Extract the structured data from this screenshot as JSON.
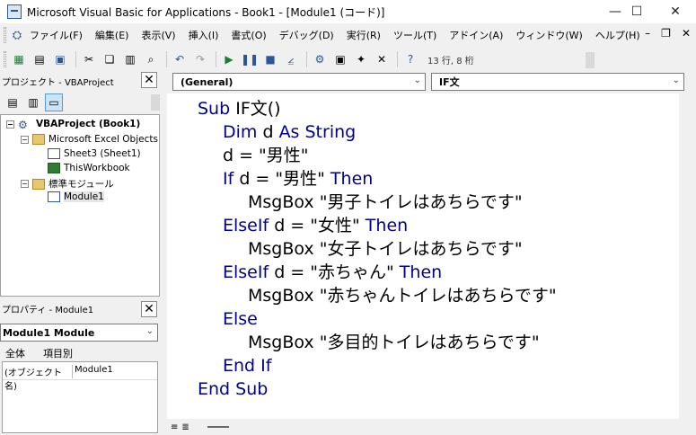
{
  "window": {
    "title": "Microsoft Visual Basic for Applications - Book1 - [Module1 (コード)]"
  },
  "menu": {
    "items": [
      "ファイル(F)",
      "編集(E)",
      "表示(V)",
      "挿入(I)",
      "書式(O)",
      "デバッグ(D)",
      "実行(R)",
      "ツール(T)",
      "アドイン(A)",
      "ウィンドウ(W)",
      "ヘルプ(H)"
    ]
  },
  "toolbar": {
    "position_text": "13 行, 8 桁"
  },
  "project_panel": {
    "title": "プロジェクト - VBAProject",
    "tree": {
      "project": "VBAProject (Book1)",
      "excel_objects": "Microsoft Excel Objects",
      "sheet": "Sheet3 (Sheet1)",
      "workbook": "ThisWorkbook",
      "modules_folder": "標準モジュール",
      "module": "Module1"
    }
  },
  "properties_panel": {
    "title": "プロパティ - Module1",
    "object_select": "Module1  Module",
    "tabs": [
      "全体",
      "項目別"
    ],
    "rows": [
      {
        "name": "(オブジェクト名)",
        "value": "Module1"
      }
    ]
  },
  "editor": {
    "object_combo": "(General)",
    "proc_combo": "IF文",
    "lines": [
      {
        "indent": 0,
        "parts": [
          {
            "t": "Sub",
            "k": true
          },
          {
            "t": " IF文()",
            "k": false
          }
        ]
      },
      {
        "indent": 1,
        "parts": [
          {
            "t": "Dim",
            "k": true
          },
          {
            "t": " d ",
            "k": false
          },
          {
            "t": "As String",
            "k": true
          }
        ]
      },
      {
        "indent": 1,
        "parts": [
          {
            "t": "d = \"男性\"",
            "k": false
          }
        ]
      },
      {
        "indent": 1,
        "parts": [
          {
            "t": "If",
            "k": true
          },
          {
            "t": " d = \"男性\" ",
            "k": false
          },
          {
            "t": "Then",
            "k": true
          }
        ]
      },
      {
        "indent": 2,
        "parts": [
          {
            "t": "MsgBox \"男子トイレはあちらです\"",
            "k": false
          }
        ]
      },
      {
        "indent": 1,
        "parts": [
          {
            "t": "ElseIf",
            "k": true
          },
          {
            "t": " d = \"女性\" ",
            "k": false
          },
          {
            "t": "Then",
            "k": true
          }
        ]
      },
      {
        "indent": 2,
        "parts": [
          {
            "t": "MsgBox \"女子トイレはあちらです\"",
            "k": false
          }
        ]
      },
      {
        "indent": 1,
        "parts": [
          {
            "t": "ElseIf",
            "k": true
          },
          {
            "t": " d = \"赤ちゃん\" ",
            "k": false
          },
          {
            "t": "Then",
            "k": true
          }
        ]
      },
      {
        "indent": 2,
        "parts": [
          {
            "t": "MsgBox \"赤ちゃんトイレはあちらです\"",
            "k": false
          }
        ]
      },
      {
        "indent": 1,
        "parts": [
          {
            "t": "Else",
            "k": true
          }
        ]
      },
      {
        "indent": 2,
        "parts": [
          {
            "t": "MsgBox \"多目的トイレはあちらです\"",
            "k": false
          }
        ]
      },
      {
        "indent": 1,
        "parts": [
          {
            "t": "End If",
            "k": true
          }
        ]
      },
      {
        "indent": 0,
        "parts": [
          {
            "t": "End Sub",
            "k": true
          }
        ]
      }
    ]
  },
  "colors": {
    "keyword": "#00008b",
    "text": "#000000"
  }
}
